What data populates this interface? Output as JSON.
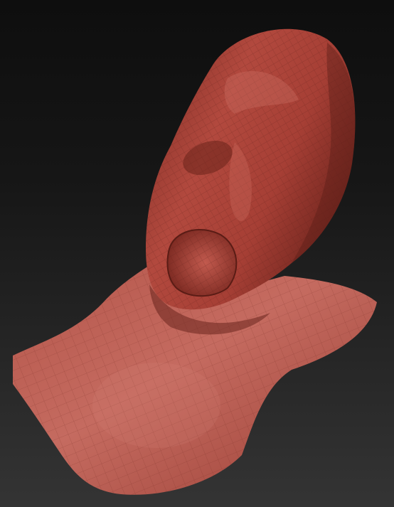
{
  "viewport": {
    "background_top": "#0e0e0e",
    "background_bottom": "#343434"
  },
  "model": {
    "material_color": "#a2443a",
    "highlight_color": "#d07a70",
    "shadow_color": "#5a1e18",
    "wireframe_color": "#7a2c24"
  }
}
